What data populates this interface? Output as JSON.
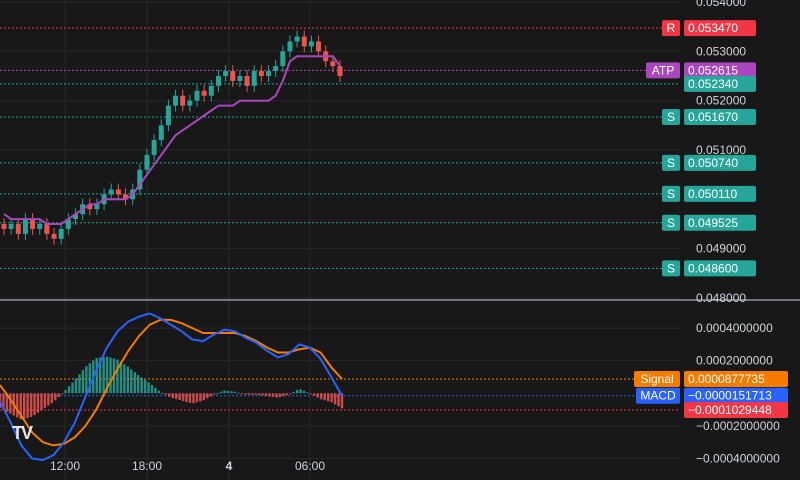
{
  "chart_data": [
    {
      "type": "candlestick",
      "y_ticks": [
        "0.054000",
        "0.053000",
        "0.052000",
        "0.051000",
        "0.049000",
        "0.048000"
      ],
      "y_tick_values": [
        0.054,
        0.053,
        0.052,
        0.051,
        0.049,
        0.048
      ],
      "ylim": [
        0.048,
        0.054
      ],
      "x_ticks": [
        "12:00",
        "18:00",
        "4",
        "06:00"
      ],
      "close_series": [
        0.0494,
        0.0495,
        0.0493,
        0.0496,
        0.0494,
        0.0495,
        0.0493,
        0.0492,
        0.0494,
        0.0496,
        0.0497,
        0.0499,
        0.0498,
        0.0499,
        0.0501,
        0.0502,
        0.0501,
        0.05,
        0.0502,
        0.0506,
        0.0509,
        0.0512,
        0.0515,
        0.0519,
        0.0521,
        0.0519,
        0.052,
        0.0522,
        0.0521,
        0.0523,
        0.0525,
        0.0526,
        0.0524,
        0.0525,
        0.0523,
        0.0526,
        0.0525,
        0.0526,
        0.0527,
        0.053,
        0.0532,
        0.0533,
        0.0531,
        0.0532,
        0.053,
        0.0528,
        0.0527,
        0.0525
      ],
      "atp_line": [
        0.0497,
        0.0496,
        0.0496,
        0.0496,
        0.0496,
        0.0496,
        0.0495,
        0.0495,
        0.0495,
        0.0496,
        0.0497,
        0.0498,
        0.0499,
        0.0499,
        0.05,
        0.05,
        0.05,
        0.05,
        0.0501,
        0.0503,
        0.0505,
        0.0507,
        0.0509,
        0.0511,
        0.0513,
        0.0514,
        0.0515,
        0.0516,
        0.0517,
        0.0518,
        0.0519,
        0.0519,
        0.0519,
        0.052,
        0.052,
        0.052,
        0.052,
        0.052,
        0.0521,
        0.0524,
        0.0528,
        0.0529,
        0.0529,
        0.0529,
        0.0529,
        0.0529,
        0.0529,
        0.0527
      ],
      "levels": [
        {
          "tag": "R",
          "value": "0.053470",
          "v": 0.05347,
          "tag_color": "#f23645",
          "value_color": "#f23645"
        },
        {
          "tag": "ATP",
          "value": "0.052615",
          "v": 0.052615,
          "tag_color": "#ab47bc",
          "value_color": "#ab47bc"
        },
        {
          "tag": "",
          "value": "0.052340",
          "v": 0.05234,
          "tag_color": "",
          "value_color": "#26a69a"
        },
        {
          "tag": "S",
          "value": "0.051670",
          "v": 0.05167,
          "tag_color": "#26a69a",
          "value_color": "#26a69a"
        },
        {
          "tag": "S",
          "value": "0.050740",
          "v": 0.05074,
          "tag_color": "#26a69a",
          "value_color": "#26a69a"
        },
        {
          "tag": "S",
          "value": "0.050110",
          "v": 0.05011,
          "tag_color": "#26a69a",
          "value_color": "#26a69a"
        },
        {
          "tag": "S",
          "value": "0.049525",
          "v": 0.049525,
          "tag_color": "#26a69a",
          "value_color": "#26a69a"
        },
        {
          "tag": "S",
          "value": "0.048600",
          "v": 0.0486,
          "tag_color": "#26a69a",
          "value_color": "#26a69a"
        }
      ],
      "colors": {
        "up": "#26a69a",
        "down": "#ef5350",
        "atp": "#ab47bc"
      }
    },
    {
      "type": "macd",
      "y_ticks": [
        "0.0004000000",
        "0.0002000000",
        "−0.0002000000",
        "−0.0004000000"
      ],
      "y_tick_values": [
        0.0004,
        0.0002,
        -0.0002,
        -0.0004
      ],
      "ylim": [
        -0.00052,
        0.00056
      ],
      "macd_series": [
        -5e-05,
        -0.00018,
        -0.00032,
        -0.0004,
        -0.00041,
        -0.00038,
        -0.0003,
        -0.00018,
        -2e-05,
        0.00014,
        0.00028,
        0.00038,
        0.00044,
        0.00047,
        0.00049,
        0.00046,
        0.00042,
        0.00038,
        0.00033,
        0.00032,
        0.00036,
        0.00039,
        0.00038,
        0.00034,
        0.00031,
        0.00026,
        0.00022,
        0.00024,
        0.0003,
        0.00028,
        0.00021,
        0.0001,
        -1.51713e-05
      ],
      "signal_series": [
        5e-05,
        -4e-05,
        -0.00014,
        -0.00024,
        -0.0003,
        -0.00032,
        -0.00031,
        -0.00027,
        -0.0002,
        -0.0001,
        3e-05,
        0.00015,
        0.00026,
        0.00035,
        0.00042,
        0.00045,
        0.00045,
        0.00043,
        0.0004,
        0.00037,
        0.00037,
        0.00037,
        0.00037,
        0.00035,
        0.00032,
        0.00028,
        0.00025,
        0.00025,
        0.00027,
        0.00028,
        0.00025,
        0.00016,
        8.77735e-05
      ],
      "labels": [
        {
          "tag": "Signal",
          "value": "0.0000877735",
          "v": 8.77735e-05,
          "tag_color": "#f57c00",
          "value_color": "#f57c00"
        },
        {
          "tag": "MACD",
          "value": "−0.0000151713",
          "v": -1.51713e-05,
          "tag_color": "#2962ff",
          "value_color": "#2962ff"
        },
        {
          "tag": "",
          "value": "−0.0001029448",
          "v": -0.0001029448,
          "tag_color": "",
          "value_color": "#f23645"
        }
      ],
      "colors": {
        "macd": "#2962ff",
        "signal": "#f57c00",
        "hist_up": "#26a69a",
        "hist_down": "#ef5350"
      }
    }
  ]
}
